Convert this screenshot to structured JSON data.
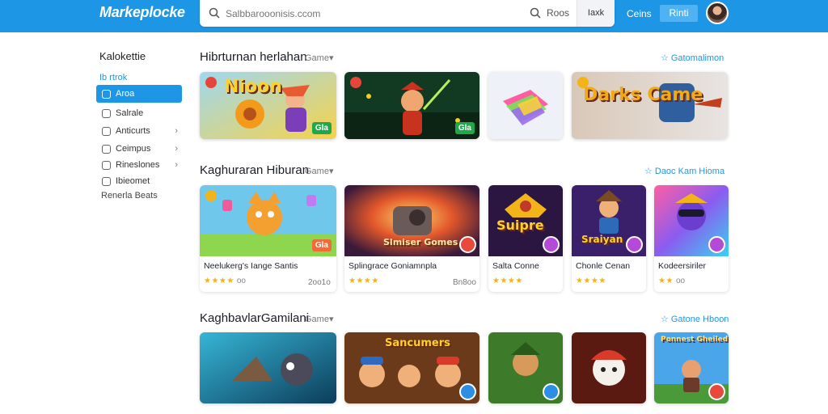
{
  "header": {
    "logo": "Markeplocke",
    "search_placeholder": "Salbbarooonisis.ccom",
    "search_label": "Roos",
    "search_button": "Iaxk",
    "link": "Ceins",
    "button": "Rinti"
  },
  "sidebar": {
    "title": "Kalokettie",
    "subtitle": "Ib rtrok",
    "items": [
      {
        "label": "Aroa",
        "active": true,
        "chevron": false
      },
      {
        "label": "Salrale",
        "active": false,
        "chevron": false
      },
      {
        "label": "Anticurts",
        "active": false,
        "chevron": true
      },
      {
        "label": "Ceimpus",
        "active": false,
        "chevron": true
      },
      {
        "label": "Rineslones",
        "active": false,
        "chevron": true
      },
      {
        "label": "Ibieomet",
        "active": false,
        "chevron": false
      }
    ],
    "footer": "Renerla Beats"
  },
  "sections": [
    {
      "title": "Hibrturnan herlahan",
      "tag": "Game",
      "link": "Gatomalimon",
      "cards": [
        {
          "art": "Nioon",
          "price": "Gla"
        },
        {
          "art": "",
          "price": "Gla"
        },
        {
          "art": "",
          "price": ""
        },
        {
          "art": "Darks Came",
          "price": ""
        }
      ]
    },
    {
      "title": "Kaghuraran Hiburan",
      "tag": "Game",
      "link": "Daoc Kam Hioma",
      "cards": [
        {
          "art": "",
          "name": "Neelukerg's Iange Santis",
          "stars": "★★★★",
          "reviews": "oo",
          "price": "Gla",
          "meta": "2oo1o"
        },
        {
          "art": "Slmiser Gomes",
          "name": "Splingrace Goniamnpla",
          "stars": "★★★★",
          "reviews": "",
          "price": "",
          "meta": "Bn8oo"
        },
        {
          "art": "Suipre",
          "name": "Salta Conne",
          "stars": "★★★★",
          "reviews": "",
          "price": "",
          "meta": ""
        },
        {
          "art": "Sraiyan",
          "name": "Chonle Cenan",
          "stars": "★★★★",
          "reviews": "",
          "price": "",
          "meta": ""
        },
        {
          "art": "",
          "name": "Kodeersiriler",
          "stars": "★★",
          "reviews": "oo",
          "price": "",
          "meta": ""
        }
      ]
    },
    {
      "title": "KaghbavlarGamilani",
      "tag": "Game",
      "link": "Gatone Hboon",
      "cards": [
        {
          "art": ""
        },
        {
          "art": "Sancumers"
        },
        {
          "art": ""
        },
        {
          "art": ""
        },
        {
          "art": "Ponnest Gheiled"
        }
      ]
    }
  ],
  "colors": {
    "accent": "#1e96e6",
    "star": "#f2b418",
    "price_green": "#1ea84a"
  }
}
